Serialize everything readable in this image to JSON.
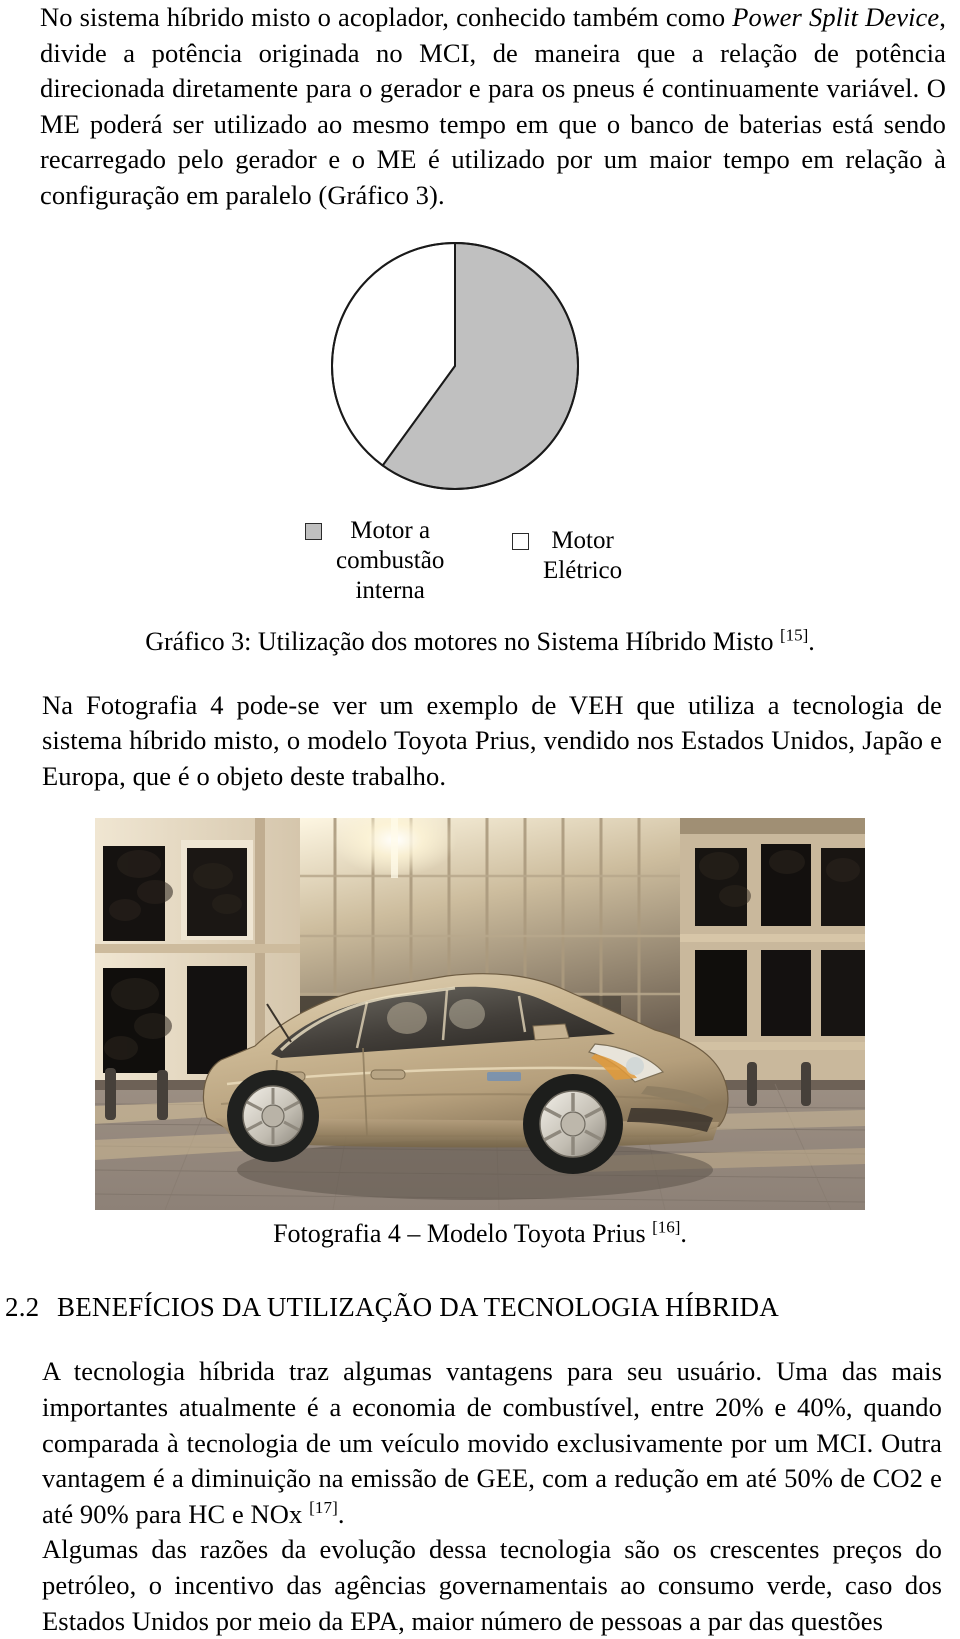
{
  "document": {
    "paragraph_1": "No sistema híbrido misto o acoplador, conhecido também como ",
    "paragraph_1_italic": "Power Split Device",
    "paragraph_1_rest": ", divide a potência originada no MCI, de maneira que a relação de potência direcionada diretamente para o gerador e para os pneus é continuamente variável. O ME poderá ser utilizado ao mesmo tempo em que o banco de baterias está sendo recarregado pelo gerador e o ME é utilizado por um maior tempo em relação à configuração em paralelo (Gráfico 3).",
    "chart_caption_text": "Gráfico 3: Utilização dos motores no Sistema Híbrido Misto ",
    "chart_caption_ref": "[15]",
    "chart_caption_end": ".",
    "paragraph_2": "Na Fotografia 4 pode-se ver um exemplo de VEH que utiliza a tecnologia de sistema híbrido misto, o modelo Toyota Prius, vendido nos Estados Unidos, Japão e Europa, que é o objeto deste trabalho.",
    "photo_caption_text": "Fotografia 4 – Modelo Toyota Prius ",
    "photo_caption_ref": "[16]",
    "photo_caption_end": ".",
    "section_number": "2.2",
    "section_title": "BENEFÍCIOS DA UTILIZAÇÃO DA TECNOLOGIA HÍBRIDA",
    "paragraph_3": "A tecnologia híbrida traz algumas vantagens para seu usuário. Uma das mais importantes atualmente é a economia de combustível, entre 20% e 40%, quando comparada à tecnologia de um veículo movido exclusivamente por um MCI. Outra vantagem é a diminuição na emissão de GEE, com a redução em até 50% de CO2 e até 90% para HC e NOx ",
    "paragraph_3_ref": "[17]",
    "paragraph_3_end": ".",
    "paragraph_4": "Algumas das razões da evolução dessa tecnologia são os crescentes preços do petróleo, o incentivo das agências governamentais ao consumo verde, caso dos Estados Unidos por meio da EPA, maior número de pessoas a par das questões"
  },
  "chart_data": {
    "type": "pie",
    "title": "Utilização dos motores no Sistema Híbrido Misto",
    "categories": [
      "Motor a combustão interna",
      "Motor Elétrico"
    ],
    "values": [
      60,
      40
    ],
    "colors": [
      "#c0c0c0",
      "#ffffff"
    ],
    "legend_position": "bottom",
    "start_angle_deg": 0,
    "direction": "clockwise",
    "slice_boundary_deg": 216,
    "labels": {
      "slice_1": "Motor a\ncombustão\ninterna",
      "slice_2": "Motor\nElétrico"
    },
    "grid": false,
    "stroke_color": "#1a1a1a"
  },
  "photo": {
    "alt_name": "toyota-prius-photograph",
    "subject": "Toyota Prius",
    "body_color": "#c5ab89",
    "background": "urban glass office building at dusk",
    "ground": "paved brick plaza"
  }
}
